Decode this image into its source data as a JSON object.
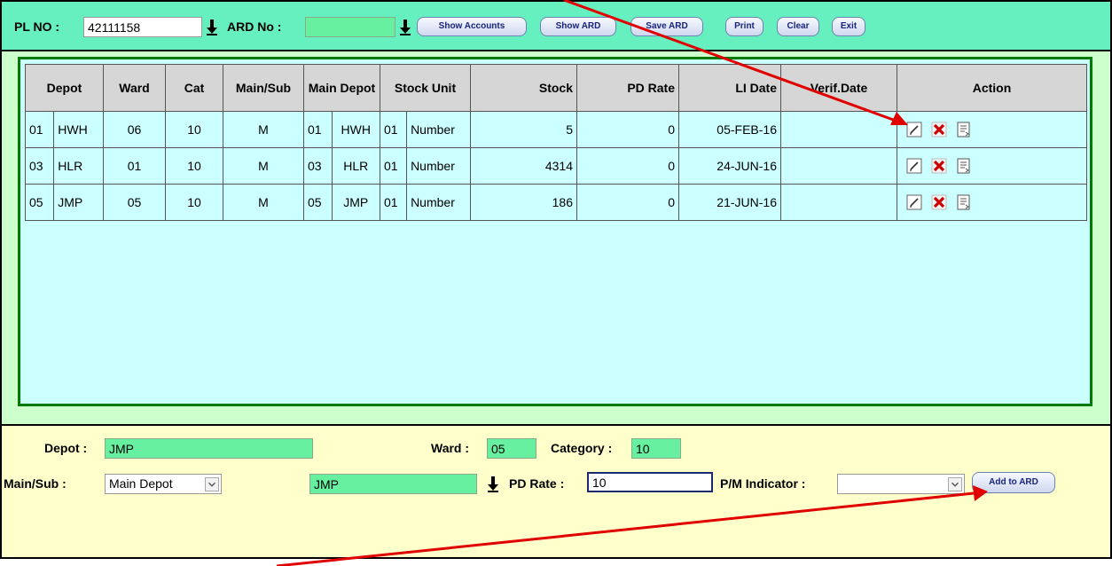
{
  "topbar": {
    "pl_no_label": "PL NO :",
    "pl_no_value": "42111158",
    "ard_no_label": "ARD No :",
    "ard_no_value": "",
    "buttons": {
      "show_accounts": "Show Accounts",
      "show_ard": "Show ARD",
      "save_ard": "Save ARD",
      "print": "Print",
      "clear": "Clear",
      "exit": "Exit"
    }
  },
  "table": {
    "headers": {
      "depot": "Depot",
      "ward": "Ward",
      "cat": "Cat",
      "main_sub": "Main/Sub",
      "main_depot": "Main Depot",
      "stock_unit": "Stock Unit",
      "stock": "Stock",
      "pd_rate": "PD Rate",
      "li_date": "LI Date",
      "verif_date": "Verif.Date",
      "action": "Action"
    },
    "rows": [
      {
        "depot_code": "01",
        "depot_name": "HWH",
        "ward": "06",
        "cat": "10",
        "main_sub": "M",
        "main_depot_code": "01",
        "main_depot_name": "HWH",
        "unit_code": "01",
        "unit_name": "Number",
        "stock": "5",
        "pd_rate": "0",
        "li_date": "05-FEB-16",
        "verif_date": ""
      },
      {
        "depot_code": "03",
        "depot_name": "HLR",
        "ward": "01",
        "cat": "10",
        "main_sub": "M",
        "main_depot_code": "03",
        "main_depot_name": "HLR",
        "unit_code": "01",
        "unit_name": "Number",
        "stock": "4314",
        "pd_rate": "0",
        "li_date": "24-JUN-16",
        "verif_date": ""
      },
      {
        "depot_code": "05",
        "depot_name": "JMP",
        "ward": "05",
        "cat": "10",
        "main_sub": "M",
        "main_depot_code": "05",
        "main_depot_name": "JMP",
        "unit_code": "01",
        "unit_name": "Number",
        "stock": "186",
        "pd_rate": "0",
        "li_date": "21-JUN-16",
        "verif_date": ""
      }
    ],
    "action_icons": [
      "edit-icon",
      "delete-icon",
      "details-icon"
    ]
  },
  "form": {
    "depot_label": "Depot :",
    "depot_value": "JMP",
    "ward_label": "Ward :",
    "ward_value": "05",
    "category_label": "Category :",
    "category_value": "10",
    "main_sub_label": "Main/Sub :",
    "main_sub_value": "Main Depot",
    "main_depot_value": "JMP",
    "pd_rate_label": "PD Rate :",
    "pd_rate_value": "10",
    "pm_indicator_label": "P/M Indicator :",
    "pm_indicator_value": "",
    "add_button": "Add to ARD"
  },
  "colors": {
    "topbar_bg": "#66f0c0",
    "panel_bg": "#ccffcc",
    "grid_bg": "#ccffff",
    "form_bg": "#ffffcc",
    "field_green": "#66f0a0",
    "annotation_arrow": "#e00000"
  }
}
